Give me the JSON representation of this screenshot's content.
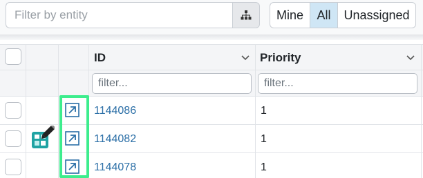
{
  "filter_bar": {
    "entity_placeholder": "Filter by entity",
    "tree_icon": "hierarchy-icon",
    "assignment_options": [
      "Mine",
      "All",
      "Unassigned"
    ],
    "selected_option": "All"
  },
  "grid": {
    "columns": [
      {
        "title": "ID",
        "filter_placeholder": "filter..."
      },
      {
        "title": "Priority",
        "filter_placeholder": "filter..."
      }
    ],
    "rows": [
      {
        "id": "1144086",
        "priority": "1",
        "open_icon": "open-external-icon",
        "status_icon": ""
      },
      {
        "id": "1144082",
        "priority": "1",
        "open_icon": "open-external-icon",
        "status_icon": "edit-entity-icon"
      },
      {
        "id": "1144078",
        "priority": "1",
        "open_icon": "open-external-icon",
        "status_icon": ""
      }
    ]
  },
  "colors": {
    "accent_link": "#2a6ea6",
    "selected_segment": "#cfe6f5",
    "highlight_outline": "#3ded8d",
    "status_icon": "#1fa3a3"
  }
}
